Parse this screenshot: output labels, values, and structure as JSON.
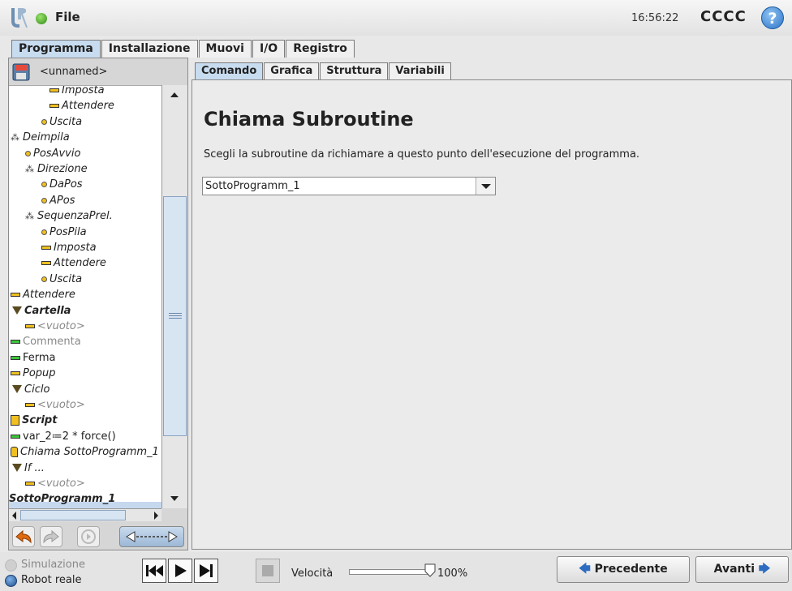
{
  "topbar": {
    "file_label": "File",
    "clock": "16:56:22",
    "robot_name": "CCCC",
    "help_label": "?"
  },
  "main_tabs": [
    "Programma",
    "Installazione",
    "Muovi",
    "I/O",
    "Registro"
  ],
  "left": {
    "program_name": "<unnamed>",
    "tree": [
      {
        "label": "Imposta",
        "icon": "set-icon",
        "style": "it"
      },
      {
        "label": "Attendere",
        "icon": "wait-icon",
        "style": "it"
      },
      {
        "label": "Uscita",
        "icon": "waypoint-icon",
        "style": "it"
      },
      {
        "label": "Deimpila",
        "icon": "move-icon",
        "style": "it"
      },
      {
        "label": "PosAvvio",
        "icon": "waypoint-icon",
        "style": "it"
      },
      {
        "label": "Direzione",
        "icon": "move-icon",
        "style": "it"
      },
      {
        "label": "DaPos",
        "icon": "waypoint-icon",
        "style": "it"
      },
      {
        "label": "APos",
        "icon": "waypoint-icon",
        "style": "it"
      },
      {
        "label": "SequenzaPrel.",
        "icon": "move-icon",
        "style": "it"
      },
      {
        "label": "PosPila",
        "icon": "waypoint-icon",
        "style": "it"
      },
      {
        "label": "Imposta",
        "icon": "set-icon",
        "style": "it"
      },
      {
        "label": "Attendere",
        "icon": "wait-icon",
        "style": "it"
      },
      {
        "label": "Uscita",
        "icon": "waypoint-icon",
        "style": "it"
      },
      {
        "label": "Attendere",
        "icon": "wait-icon",
        "style": "it"
      },
      {
        "label": "Cartella",
        "icon": "folder-icon",
        "style": "it bold"
      },
      {
        "label": "<vuoto>",
        "icon": "empty-icon",
        "style": "it grey"
      },
      {
        "label": "Commenta",
        "icon": "comment-icon",
        "style": "grey"
      },
      {
        "label": "Ferma",
        "icon": "halt-icon",
        "style": ""
      },
      {
        "label": "Popup",
        "icon": "popup-icon",
        "style": "it"
      },
      {
        "label": "Ciclo",
        "icon": "loop-icon",
        "style": "it"
      },
      {
        "label": "<vuoto>",
        "icon": "empty-icon",
        "style": "it grey"
      },
      {
        "label": "Script",
        "icon": "script-icon",
        "style": "it bold"
      },
      {
        "label": "var_2≔2 * force()",
        "icon": "assignment-icon",
        "style": ""
      },
      {
        "label": "Chiama SottoProgramm_1",
        "icon": "call-subroutine-icon",
        "style": "it"
      },
      {
        "label": "If ...",
        "icon": "if-icon",
        "style": "it"
      },
      {
        "label": "<vuoto>",
        "icon": "empty-icon",
        "style": "it grey"
      },
      {
        "label": "SottoProgramm_1",
        "icon": "subroutine-icon",
        "style": "it bold"
      }
    ]
  },
  "sub_tabs": [
    "Comando",
    "Grafica",
    "Struttura",
    "Variabili"
  ],
  "command": {
    "title": "Chiama Subroutine",
    "description": "Scegli la subroutine da richiamare a questo punto dell'esecuzione del programma.",
    "selected_subroutine": "SottoProgramm_1"
  },
  "bottom": {
    "mode_simulation": "Simulazione",
    "mode_real": "Robot reale",
    "speed_label": "Velocità",
    "speed_value": "100%",
    "speed_fraction": 1.0,
    "prev_label": "Precedente",
    "next_label": "Avanti"
  },
  "colors": {
    "accent": "#c8dcf0",
    "status_ok": "#2f8a17",
    "selection": "#c5d8ee"
  }
}
